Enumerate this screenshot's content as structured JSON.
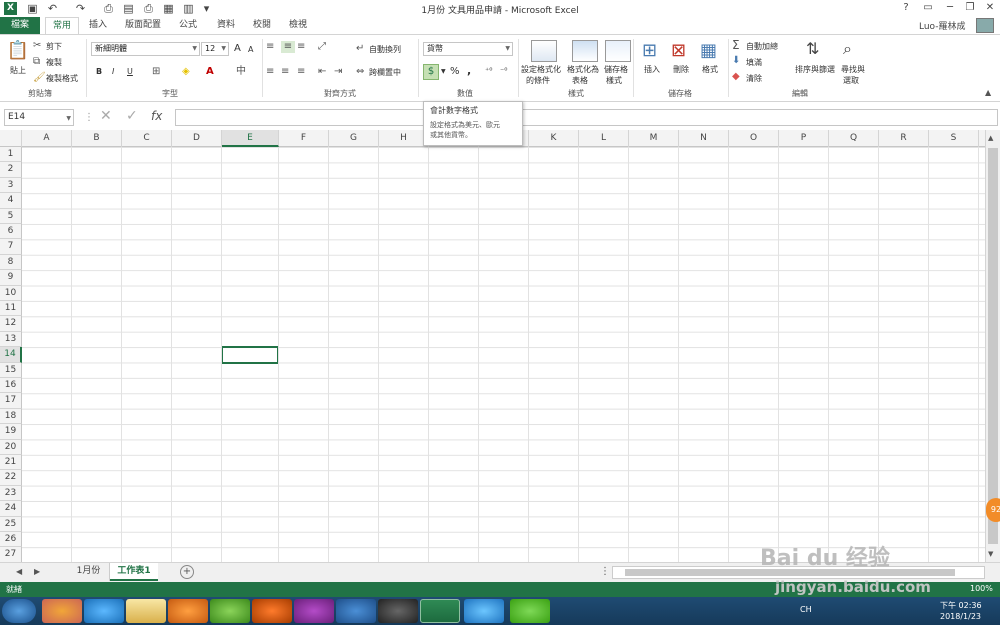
{
  "window": {
    "title": "1月份 文具用品申請 - Microsoft Excel",
    "user": "Luo-羅林成"
  },
  "tabs": [
    "檔案",
    "常用",
    "插入",
    "版面配置",
    "公式",
    "資料",
    "校閱",
    "檢視"
  ],
  "clipboard": {
    "paste": "貼上",
    "cut": "剪下",
    "copy": "複製",
    "painter": "複製格式",
    "label": "剪貼簿"
  },
  "font": {
    "name": "新細明體",
    "size": "12",
    "bold": "B",
    "italic": "I",
    "underline": "U",
    "grow": "A",
    "shrink": "A",
    "label": "字型"
  },
  "alignment": {
    "wrap": "自動換列",
    "merge": "跨欄置中",
    "label": "對齊方式"
  },
  "number": {
    "format": "貨幣",
    "currency": "$",
    "percent": "%",
    "comma": ",",
    "inc": "⁺⁰",
    "dec": "⁻⁰",
    "label": "數值"
  },
  "styles": {
    "cond": [
      "設定格式化",
      "的條件"
    ],
    "table": [
      "格式化為",
      "表格"
    ],
    "cell": [
      "儲存格",
      "樣式"
    ],
    "label": "樣式"
  },
  "cells": {
    "insert": "插入",
    "delete": "刪除",
    "format": "格式",
    "label": "儲存格"
  },
  "editing": {
    "autosum": "自動加總",
    "fill": "填滿",
    "clear": "清除",
    "sort": [
      "排序與篩選",
      ""
    ],
    "find": [
      "尋找與",
      "選取"
    ],
    "label": "編輯"
  },
  "tooltip": {
    "title": "會計數字格式",
    "desc": [
      "設定格式為美元、歐元",
      "或其他貨幣。"
    ]
  },
  "namebox": "E14",
  "fx": "fx",
  "columns": [
    "A",
    "B",
    "C",
    "D",
    "E",
    "F",
    "G",
    "H",
    "I",
    "J",
    "K",
    "L",
    "M",
    "N",
    "O",
    "P",
    "Q",
    "R",
    "S"
  ],
  "rows": [
    "1",
    "2",
    "3",
    "4",
    "5",
    "6",
    "7",
    "8",
    "9",
    "10",
    "11",
    "12",
    "13",
    "14",
    "15",
    "16",
    "17",
    "18",
    "19",
    "20",
    "21",
    "22",
    "23",
    "24",
    "25",
    "26",
    "27"
  ],
  "selected": {
    "col": "E",
    "row": "14"
  },
  "sheets": [
    "1月份",
    "工作表1"
  ],
  "status": {
    "left": "就緒",
    "zoom": "100%"
  },
  "clock": {
    "time": "下午 02:36",
    "date": "2018/1/23"
  },
  "tray": {
    "lang": "CH"
  },
  "watermark": {
    "line1": "Bai du 经验",
    "line2": "jingyan.baidu.com"
  },
  "badge": "92"
}
